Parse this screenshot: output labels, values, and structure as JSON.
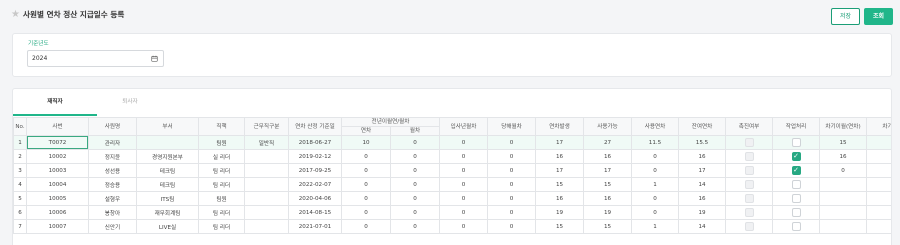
{
  "header": {
    "star_icon": "star-icon",
    "title": "사원별 연차 정산 지급일수 등록",
    "save_label": "저장",
    "search_label": "조회"
  },
  "filter": {
    "year_label": "기준년도",
    "year_value": "2024",
    "calendar_icon": "calendar-icon"
  },
  "tabs": [
    {
      "label": "재직자",
      "active": true
    },
    {
      "label": "퇴사자",
      "active": false
    }
  ],
  "grid": {
    "headers": {
      "no": "No.",
      "emp_no": "사번",
      "name": "사원명",
      "dept": "부서",
      "position": "직책",
      "work_type": "근무직구분",
      "base_date": "연차 산정 기준일",
      "prev_group": "전년이월연/월차",
      "prev_annual": "연차",
      "prev_monthly": "월차",
      "join_month": "입사년월차",
      "cur_month": "당해월차",
      "annual_gen": "연차발생",
      "usable": "사용가능",
      "used": "사용연차",
      "remaining": "잔여연차",
      "promote": "촉진여부",
      "process": "작업처리",
      "carryover": "차기이월(연차)",
      "extra": "차기"
    },
    "rows": [
      {
        "no": "1",
        "emp_no": "T0072",
        "name": "관리자",
        "dept": "",
        "position": "팀원",
        "work_type": "일반직",
        "base_date": "2018-06-27",
        "prev_annual": "10",
        "prev_monthly": "0",
        "join_month": "0",
        "cur_month": "0",
        "annual_gen": "17",
        "usable": "27",
        "used": "11.5",
        "remaining": "15.5",
        "checked": false,
        "carryover": "15"
      },
      {
        "no": "2",
        "emp_no": "10002",
        "name": "정지윤",
        "dept": "경영지원본부",
        "position": "실 리더",
        "work_type": "",
        "base_date": "2019-02-12",
        "prev_annual": "0",
        "prev_monthly": "0",
        "join_month": "0",
        "cur_month": "0",
        "annual_gen": "16",
        "usable": "16",
        "used": "0",
        "remaining": "16",
        "checked": true,
        "carryover": "16"
      },
      {
        "no": "3",
        "emp_no": "10003",
        "name": "성선용",
        "dept": "테크팀",
        "position": "팀 리더",
        "work_type": "",
        "base_date": "2017-09-25",
        "prev_annual": "0",
        "prev_monthly": "0",
        "join_month": "0",
        "cur_month": "0",
        "annual_gen": "17",
        "usable": "17",
        "used": "0",
        "remaining": "17",
        "checked": true,
        "carryover": "0"
      },
      {
        "no": "4",
        "emp_no": "10004",
        "name": "정승용",
        "dept": "테크팀",
        "position": "팀 리더",
        "work_type": "",
        "base_date": "2022-02-07",
        "prev_annual": "0",
        "prev_monthly": "0",
        "join_month": "0",
        "cur_month": "0",
        "annual_gen": "15",
        "usable": "15",
        "used": "1",
        "remaining": "14",
        "checked": false,
        "carryover": ""
      },
      {
        "no": "5",
        "emp_no": "10005",
        "name": "설형우",
        "dept": "ITS팀",
        "position": "팀원",
        "work_type": "",
        "base_date": "2020-04-06",
        "prev_annual": "0",
        "prev_monthly": "0",
        "join_month": "0",
        "cur_month": "0",
        "annual_gen": "16",
        "usable": "16",
        "used": "0",
        "remaining": "16",
        "checked": false,
        "carryover": ""
      },
      {
        "no": "6",
        "emp_no": "10006",
        "name": "봉창아",
        "dept": "재무회계팀",
        "position": "팀 리더",
        "work_type": "",
        "base_date": "2014-08-15",
        "prev_annual": "0",
        "prev_monthly": "0",
        "join_month": "0",
        "cur_month": "0",
        "annual_gen": "19",
        "usable": "19",
        "used": "0",
        "remaining": "19",
        "checked": false,
        "carryover": ""
      },
      {
        "no": "7",
        "emp_no": "10007",
        "name": "신안기",
        "dept": "LIVE실",
        "position": "팀 리더",
        "work_type": "",
        "base_date": "2021-07-01",
        "prev_annual": "0",
        "prev_monthly": "0",
        "join_month": "0",
        "cur_month": "0",
        "annual_gen": "15",
        "usable": "15",
        "used": "1",
        "remaining": "14",
        "checked": false,
        "carryover": ""
      }
    ]
  },
  "colors": {
    "accent": "#20b68a",
    "accent_dark": "#1b9e77"
  }
}
